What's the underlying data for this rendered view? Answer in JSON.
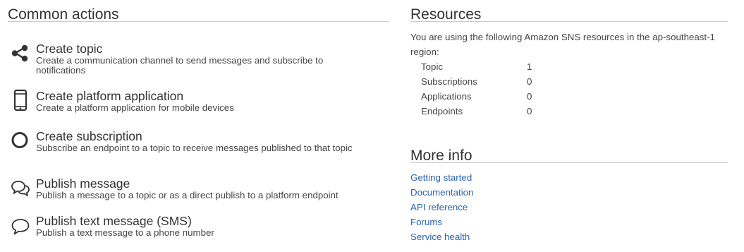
{
  "common_actions": {
    "heading": "Common actions",
    "items": [
      {
        "icon": "share-icon",
        "title": "Create topic",
        "description": "Create a communication channel to send messages and subscribe to notifications"
      },
      {
        "icon": "mobile-device-icon",
        "title": "Create platform application",
        "description": "Create a platform application for mobile devices"
      },
      {
        "icon": "circle-icon",
        "title": "Create subscription",
        "description": "Subscribe an endpoint to a topic to receive messages published to that topic"
      },
      {
        "icon": "chat-bubbles-icon",
        "title": "Publish message",
        "description": "Publish a message to a topic or as a direct publish to a platform endpoint"
      },
      {
        "icon": "speech-bubble-icon",
        "title": "Publish text message (SMS)",
        "description": "Publish a text message to a phone number"
      }
    ]
  },
  "resources": {
    "heading": "Resources",
    "intro": "You are using the following Amazon SNS resources in the ap-southeast-1 region:",
    "rows": [
      {
        "name": "Topic",
        "count": "1"
      },
      {
        "name": "Subscriptions",
        "count": "0"
      },
      {
        "name": "Applications",
        "count": "0"
      },
      {
        "name": "Endpoints",
        "count": "0"
      }
    ]
  },
  "more_info": {
    "heading": "More info",
    "links": [
      "Getting started",
      "Documentation",
      "API reference",
      "Forums",
      "Service health"
    ]
  },
  "colors": {
    "link": "#2a63b0",
    "text": "#333333",
    "divider": "#cccccc"
  }
}
